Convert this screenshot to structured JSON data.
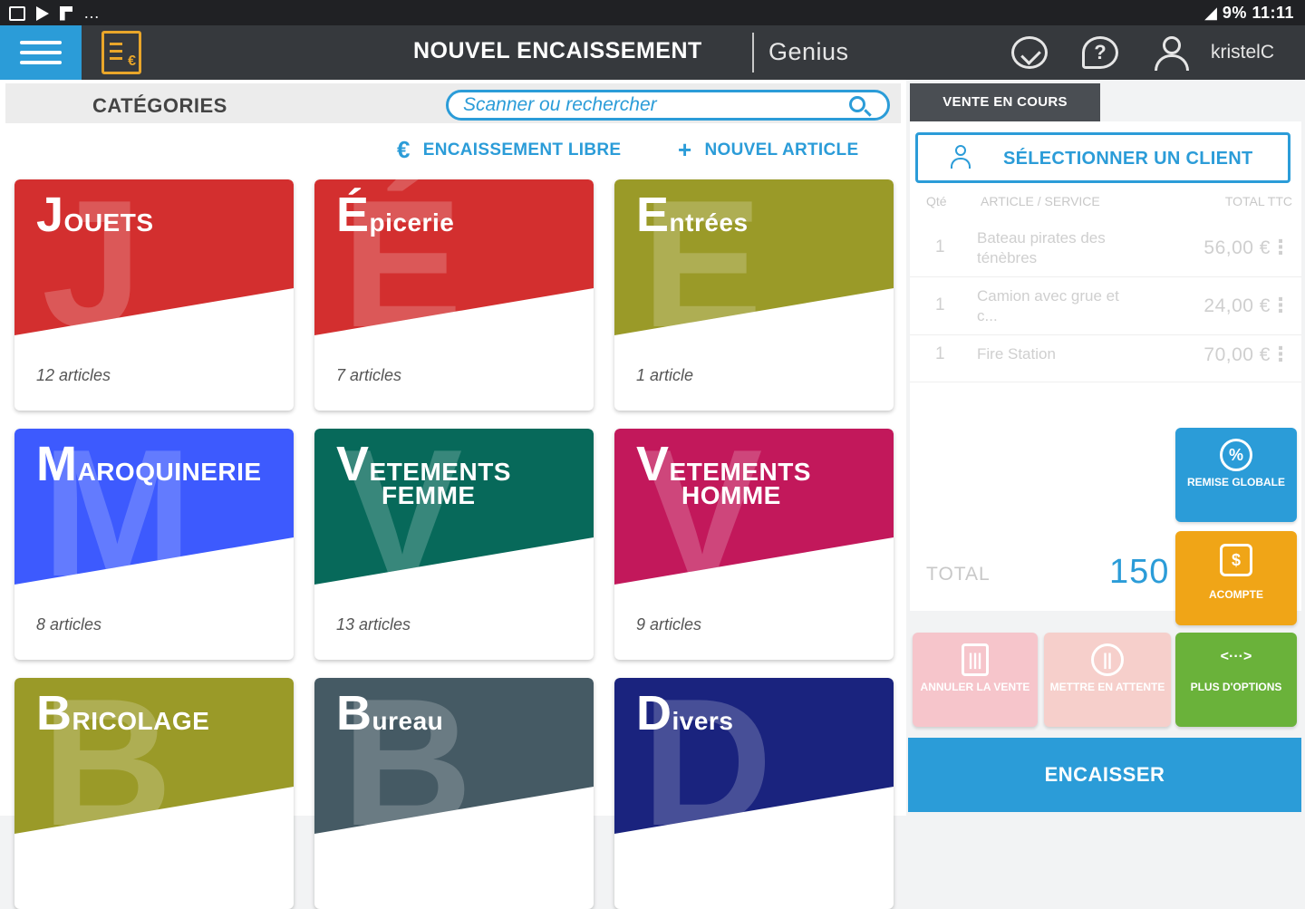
{
  "status_bar": {
    "right_text": "9% 11:11"
  },
  "header": {
    "title": "NOUVEL ENCAISSEMENT",
    "brand": "Genius",
    "username": "kristelC"
  },
  "categories_panel": {
    "title": "CATÉGORIES",
    "search_placeholder": "Scanner ou rechercher",
    "encaissement_libre_glyph": "€",
    "encaissement_libre_label": "ENCAISSEMENT LIBRE",
    "nouvel_article_glyph": "+",
    "nouvel_article_label": "NOUVEL ARTICLE",
    "cards": [
      {
        "initial": "J",
        "rest": "OUETS",
        "rest2": "",
        "count": "12 articles",
        "color": "#d32f2f"
      },
      {
        "initial": "É",
        "rest": "picerie",
        "rest2": "",
        "count": "7 articles",
        "color": "#d32f2f"
      },
      {
        "initial": "E",
        "rest": "ntrées",
        "rest2": "",
        "count": "1 article",
        "color": "#9a9a28"
      },
      {
        "initial": "M",
        "rest": "AROQUINERIE",
        "rest2": "",
        "count": "8 articles",
        "color": "#3d5afe"
      },
      {
        "initial": "V",
        "rest": "ETEMENTS",
        "rest2": "FEMME",
        "count": "13 articles",
        "color": "#07695a"
      },
      {
        "initial": "V",
        "rest": "ETEMENTS",
        "rest2": "HOMME",
        "count": "9 articles",
        "color": "#c2185b"
      },
      {
        "initial": "B",
        "rest": "RICOLAGE",
        "rest2": "",
        "count": "",
        "color": "#9a9a28"
      },
      {
        "initial": "B",
        "rest": "ureau",
        "rest2": "",
        "count": "",
        "color": "#455a64"
      },
      {
        "initial": "D",
        "rest": "ivers",
        "rest2": "",
        "count": "",
        "color": "#1a237e"
      }
    ]
  },
  "sale_panel": {
    "tab_label": "VENTE EN COURS",
    "select_client": "SÉLECTIONNER UN CLIENT",
    "columns": {
      "qty": "Qté",
      "article": "ARTICLE / SERVICE",
      "total": "TOTAL TTC"
    },
    "rows": [
      {
        "qty": "1",
        "name": "Bateau pirates des ténèbres",
        "price": "56,00 €"
      },
      {
        "qty": "1",
        "name": "Camion avec grue et c...",
        "price": "24,00 €"
      },
      {
        "qty": "1",
        "name": "Fire Station",
        "price": "70,00 €"
      }
    ],
    "total_label": "TOTAL",
    "total_value": "150",
    "remise_glyph": "%",
    "remise_label": "REMISE GLOBALE",
    "acompte_glyph": "$",
    "acompte_label": "ACOMPTE",
    "annuler_glyph": "|||",
    "annuler_label": "ANNULER LA VENTE",
    "attente_glyph": "||",
    "attente_label": "METTRE EN ATTENTE",
    "options_glyph": "<···>",
    "options_label": "PLUS D'OPTIONS",
    "encaisser": "ENCAISSER"
  },
  "colors": {
    "accent": "#2b9cd8",
    "header_bg": "#36393d",
    "acompte": "#f0a517",
    "options": "#6ab23a"
  }
}
